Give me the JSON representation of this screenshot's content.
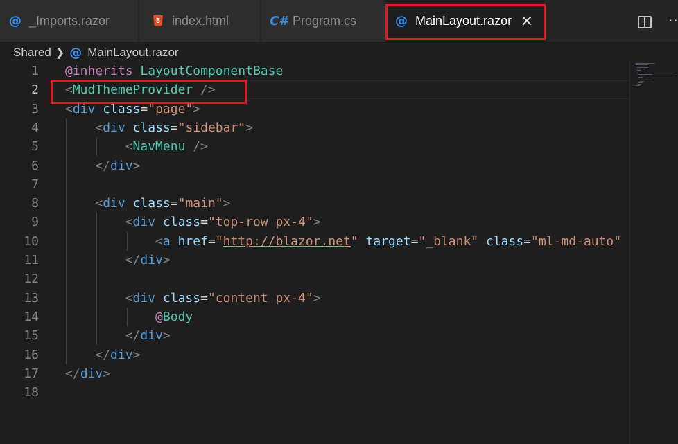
{
  "tabs": [
    {
      "label": "_Imports.razor",
      "icon": "razor-at-icon"
    },
    {
      "label": "index.html",
      "icon": "html5-icon"
    },
    {
      "label": "Program.cs",
      "icon": "csharp-icon",
      "icon_text": "C#"
    },
    {
      "label": "MainLayout.razor",
      "icon": "razor-at-icon",
      "active": true
    }
  ],
  "html5_icon_text": "5",
  "at_symbol": "@",
  "breadcrumb": {
    "folder": "Shared",
    "file": "MainLayout.razor"
  },
  "more_label": "···",
  "colors": {
    "highlight": "#e21b23",
    "keyword": "#c586c0",
    "type": "#4ec9b0",
    "tag": "#569cd6",
    "attribute": "#9cdcfe",
    "string": "#ce9178"
  },
  "code_lines": [
    {
      "n": "1",
      "text": "@inherits LayoutComponentBase"
    },
    {
      "n": "2",
      "text": "<MudThemeProvider />"
    },
    {
      "n": "3",
      "text": "<div class=\"page\">"
    },
    {
      "n": "4",
      "text": "    <div class=\"sidebar\">"
    },
    {
      "n": "5",
      "text": "        <NavMenu />"
    },
    {
      "n": "6",
      "text": "    </div>"
    },
    {
      "n": "7",
      "text": ""
    },
    {
      "n": "8",
      "text": "    <div class=\"main\">"
    },
    {
      "n": "9",
      "text": "        <div class=\"top-row px-4\">"
    },
    {
      "n": "10",
      "text": "            <a href=\"http://blazor.net\" target=\"_blank\" class=\"ml-md-auto\""
    },
    {
      "n": "11",
      "text": "        </div>"
    },
    {
      "n": "12",
      "text": ""
    },
    {
      "n": "13",
      "text": "        <div class=\"content px-4\">"
    },
    {
      "n": "14",
      "text": "            @Body"
    },
    {
      "n": "15",
      "text": "        </div>"
    },
    {
      "n": "16",
      "text": "    </div>"
    },
    {
      "n": "17",
      "text": "</div>"
    },
    {
      "n": "18",
      "text": ""
    }
  ]
}
